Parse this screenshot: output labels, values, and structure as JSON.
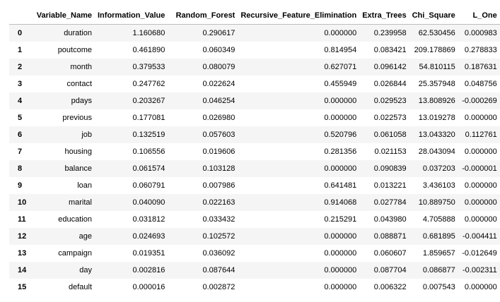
{
  "table": {
    "columns": [
      "",
      "Variable_Name",
      "Information_Value",
      "Random_Forest",
      "Recursive_Feature_Elimination",
      "Extra_Trees",
      "Chi_Square",
      "L_One"
    ],
    "rows": [
      [
        "0",
        "duration",
        "1.160680",
        "0.290617",
        "0.000000",
        "0.239958",
        "62.530456",
        "0.000983"
      ],
      [
        "1",
        "poutcome",
        "0.461890",
        "0.060349",
        "0.814954",
        "0.083421",
        "209.178869",
        "0.278833"
      ],
      [
        "2",
        "month",
        "0.379533",
        "0.080079",
        "0.627071",
        "0.096142",
        "54.810115",
        "0.187631"
      ],
      [
        "3",
        "contact",
        "0.247762",
        "0.022624",
        "0.455949",
        "0.026844",
        "25.357948",
        "0.048756"
      ],
      [
        "4",
        "pdays",
        "0.203267",
        "0.046254",
        "0.000000",
        "0.029523",
        "13.808926",
        "-0.000269"
      ],
      [
        "5",
        "previous",
        "0.177081",
        "0.026980",
        "0.000000",
        "0.022573",
        "13.019278",
        "0.000000"
      ],
      [
        "6",
        "job",
        "0.132519",
        "0.057603",
        "0.520796",
        "0.061058",
        "13.043320",
        "0.112761"
      ],
      [
        "7",
        "housing",
        "0.106556",
        "0.019606",
        "0.281356",
        "0.021153",
        "28.043094",
        "0.000000"
      ],
      [
        "8",
        "balance",
        "0.061574",
        "0.103128",
        "0.000000",
        "0.090839",
        "0.037203",
        "-0.000001"
      ],
      [
        "9",
        "loan",
        "0.060791",
        "0.007986",
        "0.641481",
        "0.013221",
        "3.436103",
        "0.000000"
      ],
      [
        "10",
        "marital",
        "0.040090",
        "0.022163",
        "0.914068",
        "0.027784",
        "10.889750",
        "0.000000"
      ],
      [
        "11",
        "education",
        "0.031812",
        "0.033432",
        "0.215291",
        "0.043980",
        "4.705888",
        "0.000000"
      ],
      [
        "12",
        "age",
        "0.024693",
        "0.102572",
        "0.000000",
        "0.088871",
        "0.681895",
        "-0.004411"
      ],
      [
        "13",
        "campaign",
        "0.019351",
        "0.036092",
        "0.000000",
        "0.060607",
        "1.859657",
        "-0.012649"
      ],
      [
        "14",
        "day",
        "0.002816",
        "0.087644",
        "0.000000",
        "0.087704",
        "0.086877",
        "-0.002311"
      ],
      [
        "15",
        "default",
        "0.000016",
        "0.002872",
        "0.000000",
        "0.006322",
        "0.007543",
        "0.000000"
      ]
    ]
  }
}
